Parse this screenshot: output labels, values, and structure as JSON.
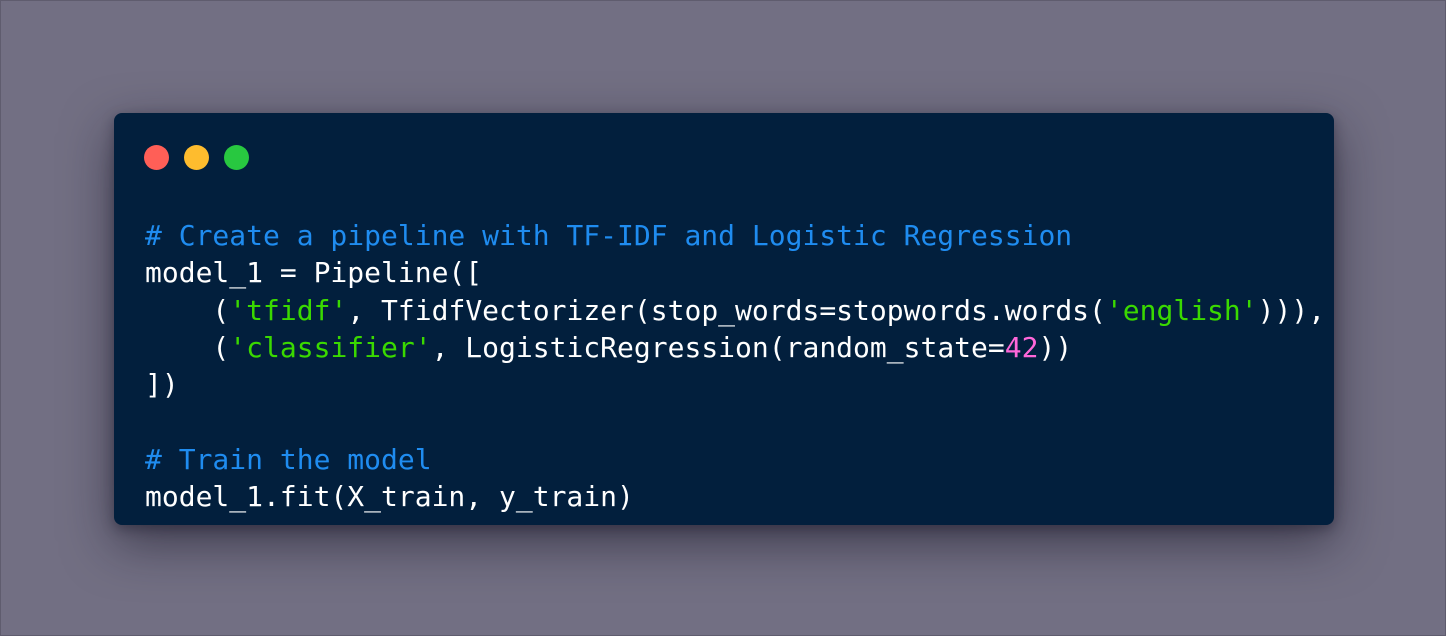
{
  "window": {
    "controls": [
      {
        "name": "close",
        "color": "#ff5f57"
      },
      {
        "name": "minimize",
        "color": "#febc2e"
      },
      {
        "name": "maximize",
        "color": "#28c840"
      }
    ]
  },
  "colors": {
    "background": "#726f83",
    "window": "#021f3d",
    "default": "#ffffff",
    "comment": "#1f8cf0",
    "string": "#3ad900",
    "number": "#ff67d9"
  },
  "code": {
    "language": "python",
    "lines": [
      [
        {
          "t": "# Create a pipeline with TF-IDF and Logistic Regression",
          "k": "comment"
        }
      ],
      [
        {
          "t": "model_1 = Pipeline([",
          "k": "default"
        }
      ],
      [
        {
          "t": "    (",
          "k": "default"
        },
        {
          "t": "'tfidf'",
          "k": "string"
        },
        {
          "t": ", TfidfVectorizer(stop_words=stopwords.words(",
          "k": "default"
        },
        {
          "t": "'english'",
          "k": "string"
        },
        {
          "t": "))),",
          "k": "default"
        }
      ],
      [
        {
          "t": "    (",
          "k": "default"
        },
        {
          "t": "'classifier'",
          "k": "string"
        },
        {
          "t": ", LogisticRegression(random_state=",
          "k": "default"
        },
        {
          "t": "42",
          "k": "number"
        },
        {
          "t": "))",
          "k": "default"
        }
      ],
      [
        {
          "t": "])",
          "k": "default"
        }
      ],
      [],
      [
        {
          "t": "# Train the model",
          "k": "comment"
        }
      ],
      [
        {
          "t": "model_1.fit(X_train, y_train)",
          "k": "default"
        }
      ]
    ]
  }
}
